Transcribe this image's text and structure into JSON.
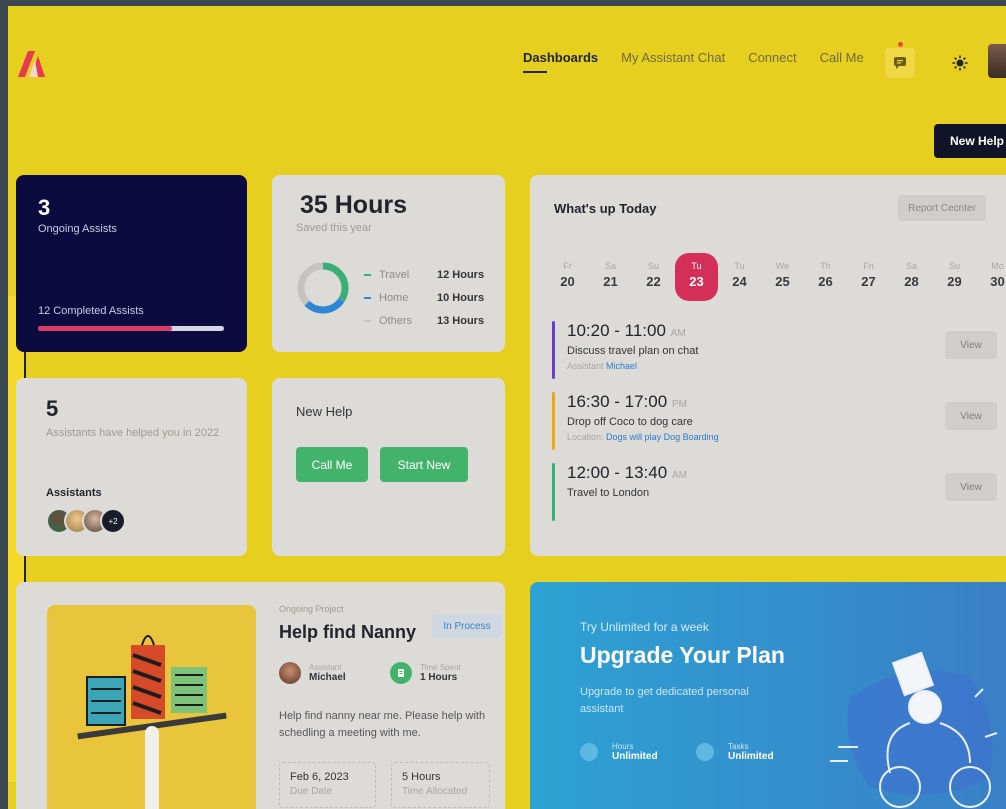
{
  "nav": {
    "items": [
      {
        "label": "Dashboards",
        "active": true
      },
      {
        "label": "My Assistant Chat",
        "active": false
      },
      {
        "label": "Connect",
        "active": false
      },
      {
        "label": "Call Me",
        "active": false
      }
    ]
  },
  "header": {
    "new_help_label": "New Help"
  },
  "assists": {
    "count": "3",
    "label": "Ongoing Assists",
    "completed": "12 Completed Assists",
    "progress": 0.72
  },
  "hours": {
    "title": "35 Hours",
    "subtitle": "Saved this year",
    "legend": [
      {
        "label": "Travel",
        "value": "12 Hours",
        "color": "#3aae74"
      },
      {
        "label": "Home",
        "value": "10 Hours",
        "color": "#2e86d6"
      },
      {
        "label": "Others",
        "value": "13 Hours",
        "color": "#c5c4c1"
      }
    ]
  },
  "today": {
    "title": "What's up Today",
    "report_label": "Report Cecnter",
    "days": [
      {
        "name": "Fr",
        "date": "20"
      },
      {
        "name": "Sa",
        "date": "21"
      },
      {
        "name": "Su",
        "date": "22"
      },
      {
        "name": "Tu",
        "date": "23",
        "selected": true
      },
      {
        "name": "Tu",
        "date": "24"
      },
      {
        "name": "We",
        "date": "25"
      },
      {
        "name": "Th",
        "date": "26"
      },
      {
        "name": "Fri",
        "date": "27"
      },
      {
        "name": "Sa",
        "date": "28"
      },
      {
        "name": "Su",
        "date": "29"
      },
      {
        "name": "Mo",
        "date": "30"
      }
    ],
    "events": [
      {
        "time": "10:20 - 11:00",
        "ampm": "AM",
        "desc": "Discuss travel plan on chat",
        "meta_label": "Assistant",
        "meta_value": "Michael",
        "color": "#6a3fc4",
        "view": "View"
      },
      {
        "time": "16:30 - 17:00",
        "ampm": "PM",
        "desc": "Drop off Coco to dog care",
        "meta_label": "Location:",
        "meta_value": "Dogs will play Dog Boarding",
        "color": "#e7a91c",
        "view": "View"
      },
      {
        "time": "12:00 - 13:40",
        "ampm": "AM",
        "desc": "Travel to London",
        "meta_label": "",
        "meta_value": "",
        "color": "#3aae74",
        "view": "View"
      }
    ]
  },
  "assistants": {
    "count": "5",
    "subtitle": "Assistants have helped you in 2022",
    "label": "Assistants",
    "more": "+2"
  },
  "new_help": {
    "title": "New Help",
    "call_label": "Call Me",
    "start_label": "Start New"
  },
  "project": {
    "label": "Ongoing Project",
    "title": "Help find Nanny",
    "status": "In Process",
    "assistant_label": "Assistant",
    "assistant_name": "Michael",
    "time_label": "Time Spent",
    "time_value": "1 Hours",
    "desc": "Help find nanny near me. Please help with schedling a meeting with me.",
    "due_value": "Feb 6, 2023",
    "due_label": "Due Date",
    "alloc_value": "5 Hours",
    "alloc_label": "Time Allocated"
  },
  "upgrade": {
    "pre": "Try Unlimited for a week",
    "title": "Upgrade Your Plan",
    "desc": "Upgrade to get dedicated personal assistant",
    "features": [
      {
        "label": "Hours",
        "value": "Unlimited"
      },
      {
        "label": "Tasks",
        "value": "Unlimited"
      }
    ]
  }
}
